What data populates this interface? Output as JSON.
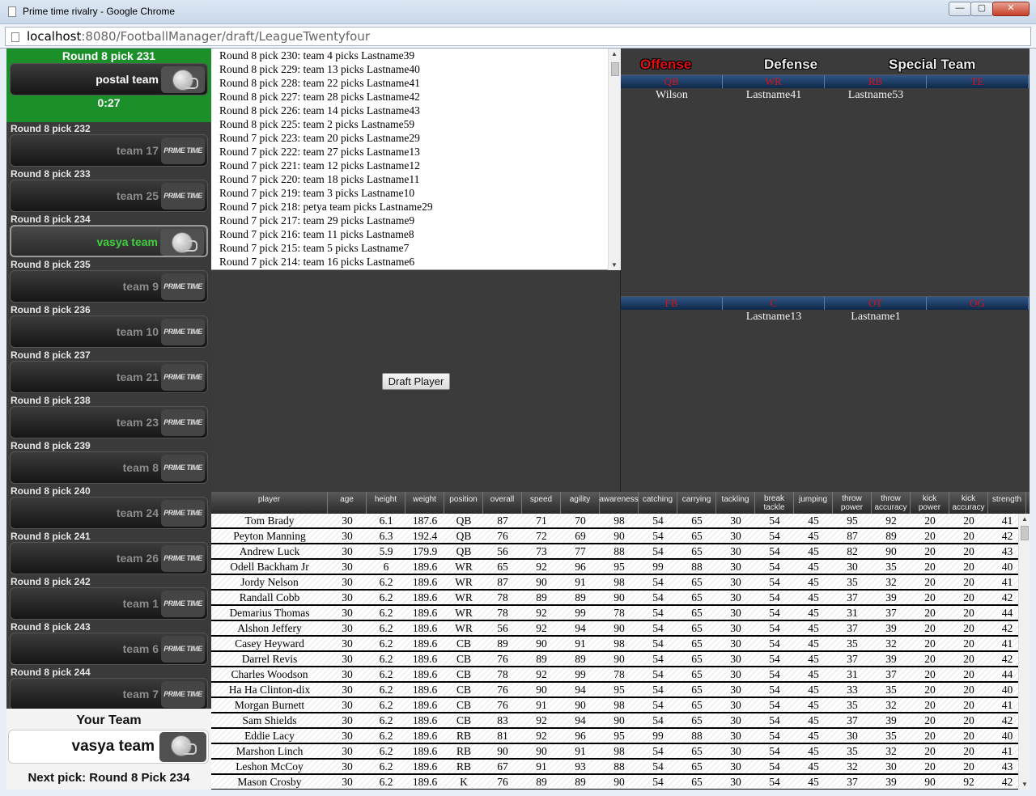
{
  "browser": {
    "title": "Prime time rivalry - Google Chrome",
    "url_host": "localhost",
    "url_rest": ":8080/FootballManager/draft/LeagueTwentyfour",
    "minimize": "—",
    "maximize": "▢",
    "close": "✕"
  },
  "current": {
    "label": "Round 8 pick 231",
    "team": "postal team",
    "timer": "0:27"
  },
  "logo_text": "PRIME TIME",
  "queue": [
    {
      "label": "Round 8 pick 232",
      "team": "team 17",
      "logo": "prime"
    },
    {
      "label": "Round 8 pick 233",
      "team": "team 25",
      "logo": "prime"
    },
    {
      "label": "Round 8 pick 234",
      "team": "vasya team",
      "logo": "helmet",
      "mine": true
    },
    {
      "label": "Round 8 pick 235",
      "team": "team 9",
      "logo": "prime"
    },
    {
      "label": "Round 8 pick 236",
      "team": "team 10",
      "logo": "prime"
    },
    {
      "label": "Round 8 pick 237",
      "team": "team 21",
      "logo": "prime"
    },
    {
      "label": "Round 8 pick 238",
      "team": "team 23",
      "logo": "prime"
    },
    {
      "label": "Round 8 pick 239",
      "team": "team 8",
      "logo": "prime"
    },
    {
      "label": "Round 8 pick 240",
      "team": "team 24",
      "logo": "prime"
    },
    {
      "label": "Round 8 pick 241",
      "team": "team 26",
      "logo": "prime"
    },
    {
      "label": "Round 8 pick 242",
      "team": "team 1",
      "logo": "prime"
    },
    {
      "label": "Round 8 pick 243",
      "team": "team 6",
      "logo": "prime"
    },
    {
      "label": "Round 8 pick 244",
      "team": "team 7",
      "logo": "prime"
    }
  ],
  "your_team": {
    "heading": "Your Team",
    "name": "vasya team",
    "next_pick": "Next pick: Round 8 Pick 234"
  },
  "draft_log": [
    "Round 8 pick 230: team 4 picks Lastname39",
    "Round 8 pick 229: team 13 picks Lastname40",
    "Round 8 pick 228: team 22 picks Lastname41",
    "Round 8 pick 227: team 28 picks Lastname42",
    "Round 8 pick 226: team 14 picks Lastname43",
    "Round 8 pick 225: team 2 picks Lastname59",
    "Round 7 pick 223: team 20 picks Lastname29",
    "Round 7 pick 222: team 27 picks Lastname13",
    "Round 7 pick 221: team 12 picks Lastname12",
    "Round 7 pick 220: team 18 picks Lastname11",
    "Round 7 pick 219: team 3 picks Lastname10",
    "Round 7 pick 218: petya team picks Lastname29",
    "Round 7 pick 217: team 29 picks Lastname9",
    "Round 7 pick 216: team 11 picks Lastname8",
    "Round 7 pick 215: team 5 picks Lastname7",
    "Round 7 pick 214: team 16 picks Lastname6"
  ],
  "draft_button": "Draft Player",
  "roster": {
    "tabs": {
      "offense": "Offense",
      "defense": "Defense",
      "special": "Special Team"
    },
    "active_tab_color": "#e01010",
    "top_positions": [
      "QB",
      "WR",
      "RB",
      "TE"
    ],
    "top_players": [
      "Wilson",
      "Lastname41",
      "Lastname53",
      ""
    ],
    "bottom_positions": [
      "FB",
      "C",
      "OT",
      "OG"
    ],
    "bottom_players": [
      "",
      "Lastname13",
      "Lastname1",
      ""
    ]
  },
  "table": {
    "columns": [
      "player",
      "age",
      "height",
      "weight",
      "position",
      "overall",
      "speed",
      "agility",
      "awareness",
      "catching",
      "carrying",
      "tackling",
      "break tackle",
      "jumping",
      "throw power",
      "throw accuracy",
      "kick power",
      "kick accuracy",
      "strength"
    ],
    "rows": [
      [
        "Tom Brady",
        "30",
        "6.1",
        "187.6",
        "QB",
        "87",
        "71",
        "70",
        "98",
        "54",
        "65",
        "30",
        "54",
        "45",
        "95",
        "92",
        "20",
        "20",
        "41"
      ],
      [
        "Peyton Manning",
        "30",
        "6.3",
        "192.4",
        "QB",
        "76",
        "72",
        "69",
        "90",
        "54",
        "65",
        "30",
        "54",
        "45",
        "87",
        "89",
        "20",
        "20",
        "42"
      ],
      [
        "Andrew Luck",
        "30",
        "5.9",
        "179.9",
        "QB",
        "56",
        "73",
        "77",
        "88",
        "54",
        "65",
        "30",
        "54",
        "45",
        "82",
        "90",
        "20",
        "20",
        "43"
      ],
      [
        "Odell Backham Jr",
        "30",
        "6",
        "189.6",
        "WR",
        "65",
        "92",
        "96",
        "95",
        "99",
        "88",
        "30",
        "54",
        "45",
        "30",
        "35",
        "20",
        "20",
        "40"
      ],
      [
        "Jordy Nelson",
        "30",
        "6.2",
        "189.6",
        "WR",
        "87",
        "90",
        "91",
        "98",
        "54",
        "65",
        "30",
        "54",
        "45",
        "35",
        "32",
        "20",
        "20",
        "41"
      ],
      [
        "Randall Cobb",
        "30",
        "6.2",
        "189.6",
        "WR",
        "78",
        "89",
        "89",
        "90",
        "54",
        "65",
        "30",
        "54",
        "45",
        "37",
        "39",
        "20",
        "20",
        "42"
      ],
      [
        "Demarius Thomas",
        "30",
        "6.2",
        "189.6",
        "WR",
        "78",
        "92",
        "99",
        "78",
        "54",
        "65",
        "30",
        "54",
        "45",
        "31",
        "37",
        "20",
        "20",
        "44"
      ],
      [
        "Alshon Jeffery",
        "30",
        "6.2",
        "189.6",
        "WR",
        "56",
        "92",
        "94",
        "90",
        "54",
        "65",
        "30",
        "54",
        "45",
        "37",
        "39",
        "20",
        "20",
        "42"
      ],
      [
        "Casey Heyward",
        "30",
        "6.2",
        "189.6",
        "CB",
        "89",
        "90",
        "91",
        "98",
        "54",
        "65",
        "30",
        "54",
        "45",
        "35",
        "32",
        "20",
        "20",
        "41"
      ],
      [
        "Darrel Revis",
        "30",
        "6.2",
        "189.6",
        "CB",
        "76",
        "89",
        "89",
        "90",
        "54",
        "65",
        "30",
        "54",
        "45",
        "37",
        "39",
        "20",
        "20",
        "42"
      ],
      [
        "Charles Woodson",
        "30",
        "6.2",
        "189.6",
        "CB",
        "78",
        "92",
        "99",
        "78",
        "54",
        "65",
        "30",
        "54",
        "45",
        "31",
        "37",
        "20",
        "20",
        "44"
      ],
      [
        "Ha Ha Clinton-dix",
        "30",
        "6.2",
        "189.6",
        "CB",
        "76",
        "90",
        "94",
        "95",
        "54",
        "65",
        "30",
        "54",
        "45",
        "33",
        "35",
        "20",
        "20",
        "40"
      ],
      [
        "Morgan Burnett",
        "30",
        "6.2",
        "189.6",
        "CB",
        "76",
        "91",
        "90",
        "98",
        "54",
        "65",
        "30",
        "54",
        "45",
        "35",
        "32",
        "20",
        "20",
        "41"
      ],
      [
        "Sam Shields",
        "30",
        "6.2",
        "189.6",
        "CB",
        "83",
        "92",
        "94",
        "90",
        "54",
        "65",
        "30",
        "54",
        "45",
        "37",
        "39",
        "20",
        "20",
        "42"
      ],
      [
        "Eddie Lacy",
        "30",
        "6.2",
        "189.6",
        "RB",
        "81",
        "92",
        "96",
        "95",
        "99",
        "88",
        "30",
        "54",
        "45",
        "30",
        "35",
        "20",
        "20",
        "40"
      ],
      [
        "Marshon Linch",
        "30",
        "6.2",
        "189.6",
        "RB",
        "90",
        "90",
        "91",
        "98",
        "54",
        "65",
        "30",
        "54",
        "45",
        "35",
        "32",
        "20",
        "20",
        "41"
      ],
      [
        "Leshon McCoy",
        "30",
        "6.2",
        "189.6",
        "RB",
        "67",
        "91",
        "93",
        "88",
        "54",
        "65",
        "30",
        "54",
        "45",
        "32",
        "30",
        "20",
        "20",
        "43"
      ],
      [
        "Mason Crosby",
        "30",
        "6.2",
        "189.6",
        "K",
        "76",
        "89",
        "89",
        "90",
        "54",
        "65",
        "30",
        "54",
        "45",
        "37",
        "39",
        "90",
        "92",
        "42"
      ]
    ]
  }
}
